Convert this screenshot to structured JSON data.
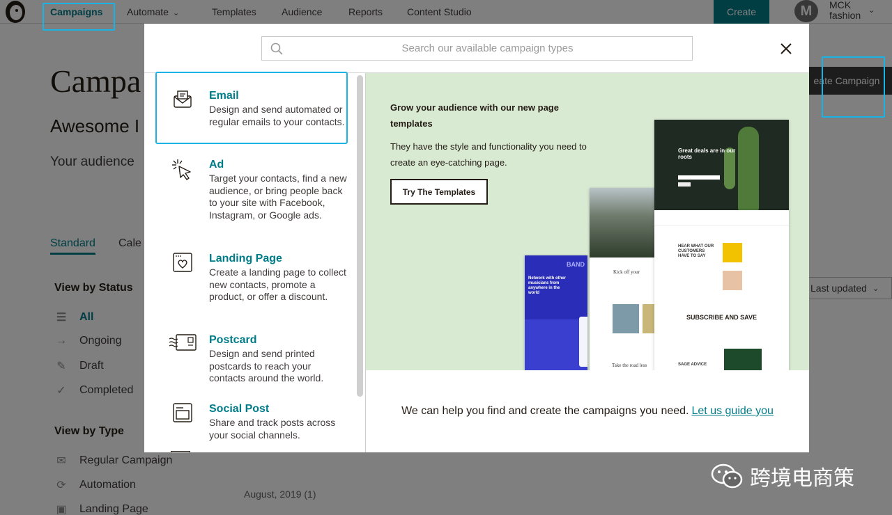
{
  "nav": {
    "items": [
      "Campaigns",
      "Automate",
      "Templates",
      "Audience",
      "Reports",
      "Content Studio"
    ],
    "create": "Create",
    "avatar_letter": "M",
    "account_line1": "MCK",
    "account_line2": "fashion"
  },
  "page": {
    "title": "Campa",
    "subtitle": "Awesome I",
    "audience_text": "Your audience",
    "tabs": [
      "Standard",
      "Cale"
    ],
    "view_by_status": "View by Status",
    "status_filters": [
      "All",
      "Ongoing",
      "Draft",
      "Completed"
    ],
    "view_by_type": "View by Type",
    "type_filters": [
      "Regular Campaign",
      "Automation",
      "Landing Page"
    ],
    "sort_label": "Last updated",
    "create_campaign": "eate Campaign",
    "month_group": "August, 2019 (1)"
  },
  "modal": {
    "search_placeholder": "Search our available campaign types",
    "types": [
      {
        "title": "Email",
        "desc": "Design and send automated or regular emails to your contacts.",
        "icon": "envelope-icon"
      },
      {
        "title": "Ad",
        "desc": "Target your contacts, find a new audience, or bring people back to your site with Facebook, Instagram, or Google ads.",
        "icon": "cursor-click-icon"
      },
      {
        "title": "Landing Page",
        "desc": "Create a landing page to collect new contacts, promote a product, or offer a discount.",
        "icon": "landing-page-icon"
      },
      {
        "title": "Postcard",
        "desc": "Design and send printed postcards to reach your contacts around the world.",
        "icon": "postcard-icon"
      },
      {
        "title": "Social Post",
        "desc": "Share and track posts across your social channels.",
        "icon": "social-post-icon"
      }
    ],
    "promo": {
      "heading": "Grow your audience with our new page templates",
      "body": "They have the style and functionality you need to create an eye-catching page.",
      "button": "Try The Templates",
      "preview_texts": {
        "deals": "Great deals are in our roots",
        "kick": "Kick off your",
        "network": "Network with other musicians from anywhere in the world",
        "band": "BAND",
        "hear": "HEAR WHAT OUR CUSTOMERS HAVE TO SAY",
        "subscribe": "SUBSCRIBE AND SAVE",
        "sage": "SAGE ADVICE",
        "take": "Take the road less"
      }
    },
    "guide_text": "We can help you find and create the campaigns you need.",
    "guide_link": "Let us guide you"
  },
  "watermark": "跨境电商策",
  "colors": {
    "accent": "#007c89",
    "promo_bg": "#d9ead3",
    "highlight": "#1ab3e6"
  }
}
